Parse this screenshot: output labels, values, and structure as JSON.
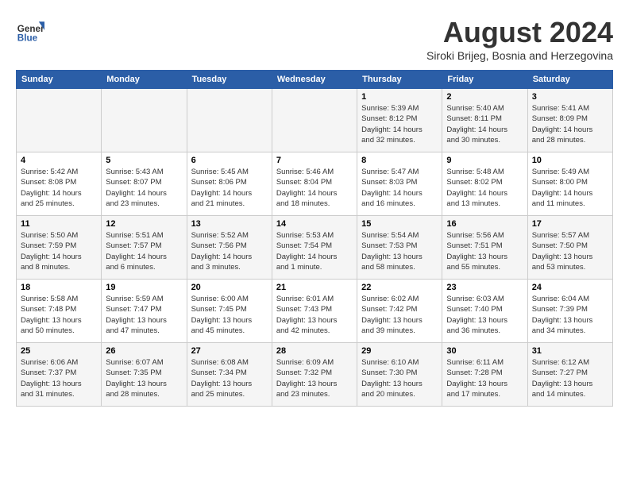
{
  "header": {
    "logo": {
      "general": "General",
      "blue": "Blue"
    },
    "title": "August 2024",
    "location": "Siroki Brijeg, Bosnia and Herzegovina"
  },
  "columns": [
    "Sunday",
    "Monday",
    "Tuesday",
    "Wednesday",
    "Thursday",
    "Friday",
    "Saturday"
  ],
  "weeks": [
    [
      {
        "day": "",
        "info": ""
      },
      {
        "day": "",
        "info": ""
      },
      {
        "day": "",
        "info": ""
      },
      {
        "day": "",
        "info": ""
      },
      {
        "day": "1",
        "info": "Sunrise: 5:39 AM\nSunset: 8:12 PM\nDaylight: 14 hours\nand 32 minutes."
      },
      {
        "day": "2",
        "info": "Sunrise: 5:40 AM\nSunset: 8:11 PM\nDaylight: 14 hours\nand 30 minutes."
      },
      {
        "day": "3",
        "info": "Sunrise: 5:41 AM\nSunset: 8:09 PM\nDaylight: 14 hours\nand 28 minutes."
      }
    ],
    [
      {
        "day": "4",
        "info": "Sunrise: 5:42 AM\nSunset: 8:08 PM\nDaylight: 14 hours\nand 25 minutes."
      },
      {
        "day": "5",
        "info": "Sunrise: 5:43 AM\nSunset: 8:07 PM\nDaylight: 14 hours\nand 23 minutes."
      },
      {
        "day": "6",
        "info": "Sunrise: 5:45 AM\nSunset: 8:06 PM\nDaylight: 14 hours\nand 21 minutes."
      },
      {
        "day": "7",
        "info": "Sunrise: 5:46 AM\nSunset: 8:04 PM\nDaylight: 14 hours\nand 18 minutes."
      },
      {
        "day": "8",
        "info": "Sunrise: 5:47 AM\nSunset: 8:03 PM\nDaylight: 14 hours\nand 16 minutes."
      },
      {
        "day": "9",
        "info": "Sunrise: 5:48 AM\nSunset: 8:02 PM\nDaylight: 14 hours\nand 13 minutes."
      },
      {
        "day": "10",
        "info": "Sunrise: 5:49 AM\nSunset: 8:00 PM\nDaylight: 14 hours\nand 11 minutes."
      }
    ],
    [
      {
        "day": "11",
        "info": "Sunrise: 5:50 AM\nSunset: 7:59 PM\nDaylight: 14 hours\nand 8 minutes."
      },
      {
        "day": "12",
        "info": "Sunrise: 5:51 AM\nSunset: 7:57 PM\nDaylight: 14 hours\nand 6 minutes."
      },
      {
        "day": "13",
        "info": "Sunrise: 5:52 AM\nSunset: 7:56 PM\nDaylight: 14 hours\nand 3 minutes."
      },
      {
        "day": "14",
        "info": "Sunrise: 5:53 AM\nSunset: 7:54 PM\nDaylight: 14 hours\nand 1 minute."
      },
      {
        "day": "15",
        "info": "Sunrise: 5:54 AM\nSunset: 7:53 PM\nDaylight: 13 hours\nand 58 minutes."
      },
      {
        "day": "16",
        "info": "Sunrise: 5:56 AM\nSunset: 7:51 PM\nDaylight: 13 hours\nand 55 minutes."
      },
      {
        "day": "17",
        "info": "Sunrise: 5:57 AM\nSunset: 7:50 PM\nDaylight: 13 hours\nand 53 minutes."
      }
    ],
    [
      {
        "day": "18",
        "info": "Sunrise: 5:58 AM\nSunset: 7:48 PM\nDaylight: 13 hours\nand 50 minutes."
      },
      {
        "day": "19",
        "info": "Sunrise: 5:59 AM\nSunset: 7:47 PM\nDaylight: 13 hours\nand 47 minutes."
      },
      {
        "day": "20",
        "info": "Sunrise: 6:00 AM\nSunset: 7:45 PM\nDaylight: 13 hours\nand 45 minutes."
      },
      {
        "day": "21",
        "info": "Sunrise: 6:01 AM\nSunset: 7:43 PM\nDaylight: 13 hours\nand 42 minutes."
      },
      {
        "day": "22",
        "info": "Sunrise: 6:02 AM\nSunset: 7:42 PM\nDaylight: 13 hours\nand 39 minutes."
      },
      {
        "day": "23",
        "info": "Sunrise: 6:03 AM\nSunset: 7:40 PM\nDaylight: 13 hours\nand 36 minutes."
      },
      {
        "day": "24",
        "info": "Sunrise: 6:04 AM\nSunset: 7:39 PM\nDaylight: 13 hours\nand 34 minutes."
      }
    ],
    [
      {
        "day": "25",
        "info": "Sunrise: 6:06 AM\nSunset: 7:37 PM\nDaylight: 13 hours\nand 31 minutes."
      },
      {
        "day": "26",
        "info": "Sunrise: 6:07 AM\nSunset: 7:35 PM\nDaylight: 13 hours\nand 28 minutes."
      },
      {
        "day": "27",
        "info": "Sunrise: 6:08 AM\nSunset: 7:34 PM\nDaylight: 13 hours\nand 25 minutes."
      },
      {
        "day": "28",
        "info": "Sunrise: 6:09 AM\nSunset: 7:32 PM\nDaylight: 13 hours\nand 23 minutes."
      },
      {
        "day": "29",
        "info": "Sunrise: 6:10 AM\nSunset: 7:30 PM\nDaylight: 13 hours\nand 20 minutes."
      },
      {
        "day": "30",
        "info": "Sunrise: 6:11 AM\nSunset: 7:28 PM\nDaylight: 13 hours\nand 17 minutes."
      },
      {
        "day": "31",
        "info": "Sunrise: 6:12 AM\nSunset: 7:27 PM\nDaylight: 13 hours\nand 14 minutes."
      }
    ]
  ]
}
